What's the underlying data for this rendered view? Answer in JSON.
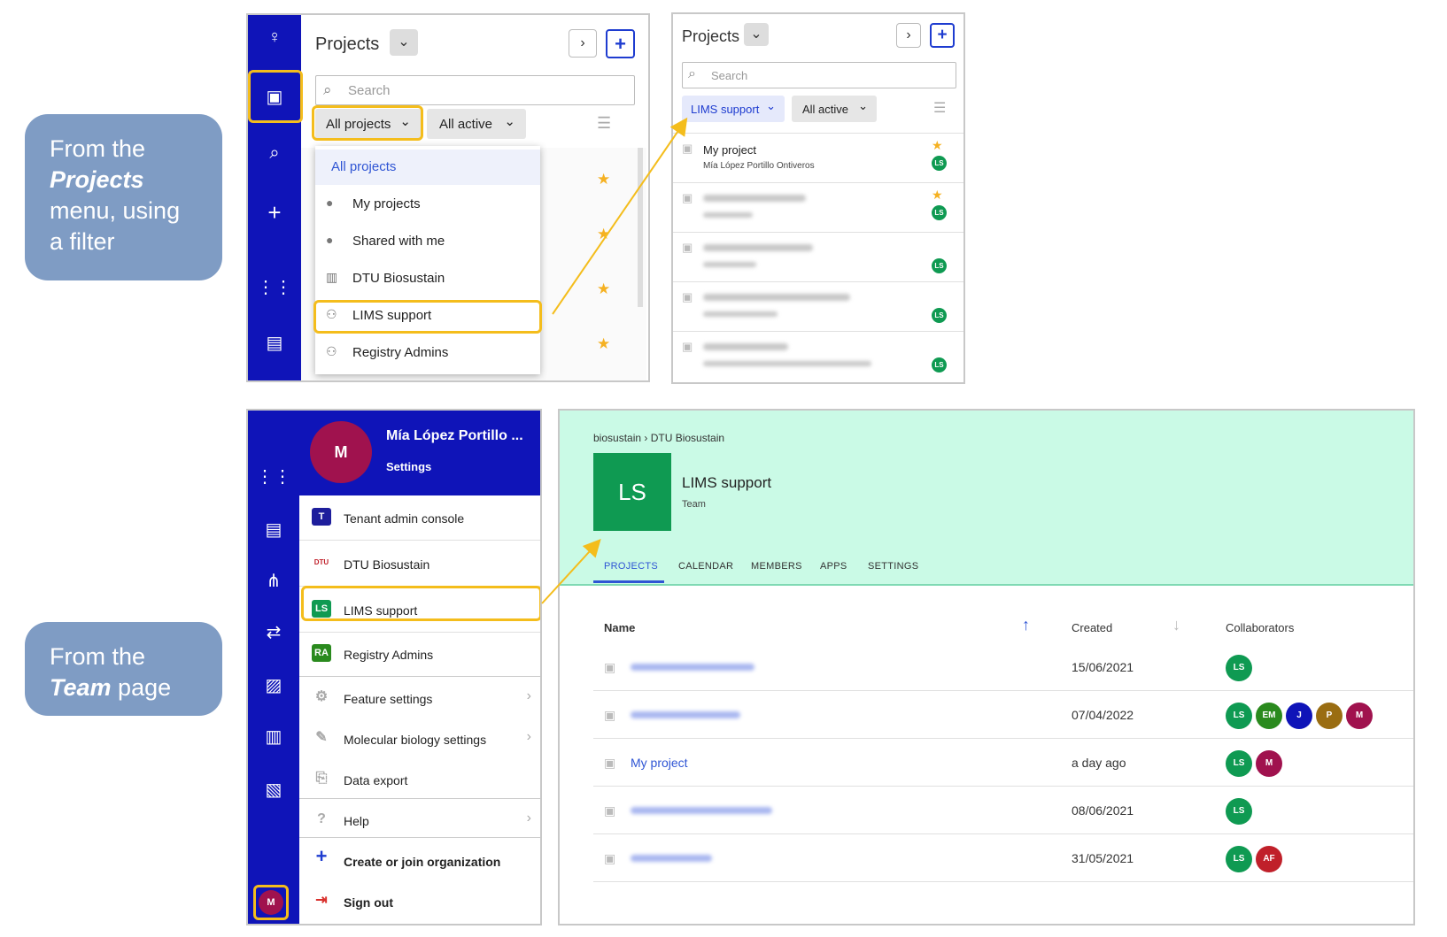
{
  "callouts": {
    "projects": {
      "l1": "From the",
      "l2": "Projects",
      "l3": "menu, using",
      "l4": "a filter"
    },
    "team": {
      "l1": "From the",
      "l2": "Team",
      "l3": "page"
    }
  },
  "panel1": {
    "title": "Projects",
    "search_placeholder": "Search",
    "filter_projects": "All projects",
    "filter_active": "All active",
    "dropdown": [
      "All projects",
      "My projects",
      "Shared with me",
      "DTU Biosustain",
      "LIMS support",
      "Registry Admins"
    ]
  },
  "panel2": {
    "title": "Projects",
    "search_placeholder": "Search",
    "filter_team": "LIMS support",
    "filter_active": "All active",
    "first_project": {
      "name": "My project",
      "owner": "Mía López Portillo Ontiveros"
    },
    "badge": "LS"
  },
  "user_menu": {
    "avatar": "M",
    "name": "Mía López Portillo ...",
    "settings": "Settings",
    "items": [
      {
        "label": "Tenant admin console",
        "icon": "T"
      },
      {
        "label": "DTU Biosustain",
        "icon": "DTU"
      },
      {
        "label": "LIMS support",
        "icon": "LS"
      },
      {
        "label": "Registry Admins",
        "icon": "RA"
      },
      {
        "label": "Feature settings",
        "icon": "gear"
      },
      {
        "label": "Molecular biology settings",
        "icon": "wrench"
      },
      {
        "label": "Data export",
        "icon": "export"
      },
      {
        "label": "Help",
        "icon": "help"
      },
      {
        "label": "Create or join organization",
        "icon": "plus"
      },
      {
        "label": "Sign out",
        "icon": "signout"
      }
    ],
    "nav_avatar": "M"
  },
  "team_page": {
    "breadcrumb": "biosustain › DTU Biosustain",
    "avatar": "LS",
    "name": "LIMS support",
    "type": "Team",
    "tabs": [
      "PROJECTS",
      "CALENDAR",
      "MEMBERS",
      "APPS",
      "SETTINGS"
    ],
    "columns": {
      "name": "Name",
      "created": "Created",
      "collaborators": "Collaborators"
    },
    "rows": [
      {
        "name": "",
        "created": "15/06/2021",
        "collab": [
          "LS"
        ]
      },
      {
        "name": "",
        "created": "07/04/2022",
        "collab": [
          "LS",
          "EM",
          "J",
          "P",
          "M"
        ]
      },
      {
        "name": "My project",
        "created": "a day ago",
        "collab": [
          "LS",
          "M"
        ]
      },
      {
        "name": "",
        "created": "08/06/2021",
        "collab": [
          "LS"
        ]
      },
      {
        "name": "",
        "created": "31/05/2021",
        "collab": [
          "LS",
          "AF"
        ]
      }
    ]
  },
  "colors": {
    "nav": "#0f14b8",
    "highlight": "#f4bd1c",
    "team_bg": "#cafae6",
    "ls_green": "#0f9a52",
    "link": "#2f55d4",
    "avatar_m": "#a0124e"
  }
}
